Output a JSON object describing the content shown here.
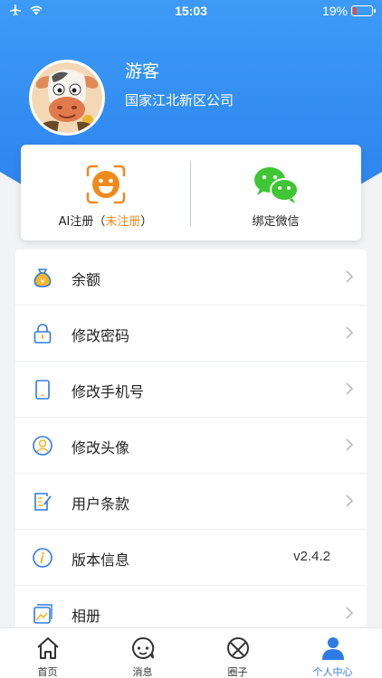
{
  "status_bar": {
    "time": "15:03",
    "battery": "19%",
    "battery_level": 0.19
  },
  "profile": {
    "name": "游客",
    "company": "国家江北新区公司"
  },
  "quick_actions": {
    "ai_register": {
      "label": "AI注册（",
      "status": "未注册",
      "suffix": "）",
      "icon": "smiley-face-scan-icon"
    },
    "bind_wechat": {
      "label": "绑定微信",
      "icon": "wechat-icon"
    }
  },
  "menu": {
    "items": [
      {
        "label": "余额",
        "icon": "money-bag-icon"
      },
      {
        "label": "修改密码",
        "icon": "lock-icon"
      },
      {
        "label": "修改手机号",
        "icon": "phone-icon"
      },
      {
        "label": "修改头像",
        "icon": "user-avatar-icon"
      },
      {
        "label": "用户条款",
        "icon": "document-edit-icon"
      },
      {
        "label": "版本信息",
        "icon": "info-icon",
        "value": "v2.4.2"
      },
      {
        "label": "相册",
        "icon": "photo-album-icon"
      }
    ]
  },
  "tabs": [
    {
      "label": "首页",
      "icon": "home-icon"
    },
    {
      "label": "消息",
      "icon": "message-icon"
    },
    {
      "label": "圈子",
      "icon": "circle-icon"
    },
    {
      "label": "个人中心",
      "icon": "person-icon",
      "active": true
    }
  ],
  "colors": {
    "brand_blue": "#2f7be4",
    "header_blue": "#2b86f0",
    "accent_orange": "#f08a1c",
    "wechat_green": "#3ec634"
  }
}
